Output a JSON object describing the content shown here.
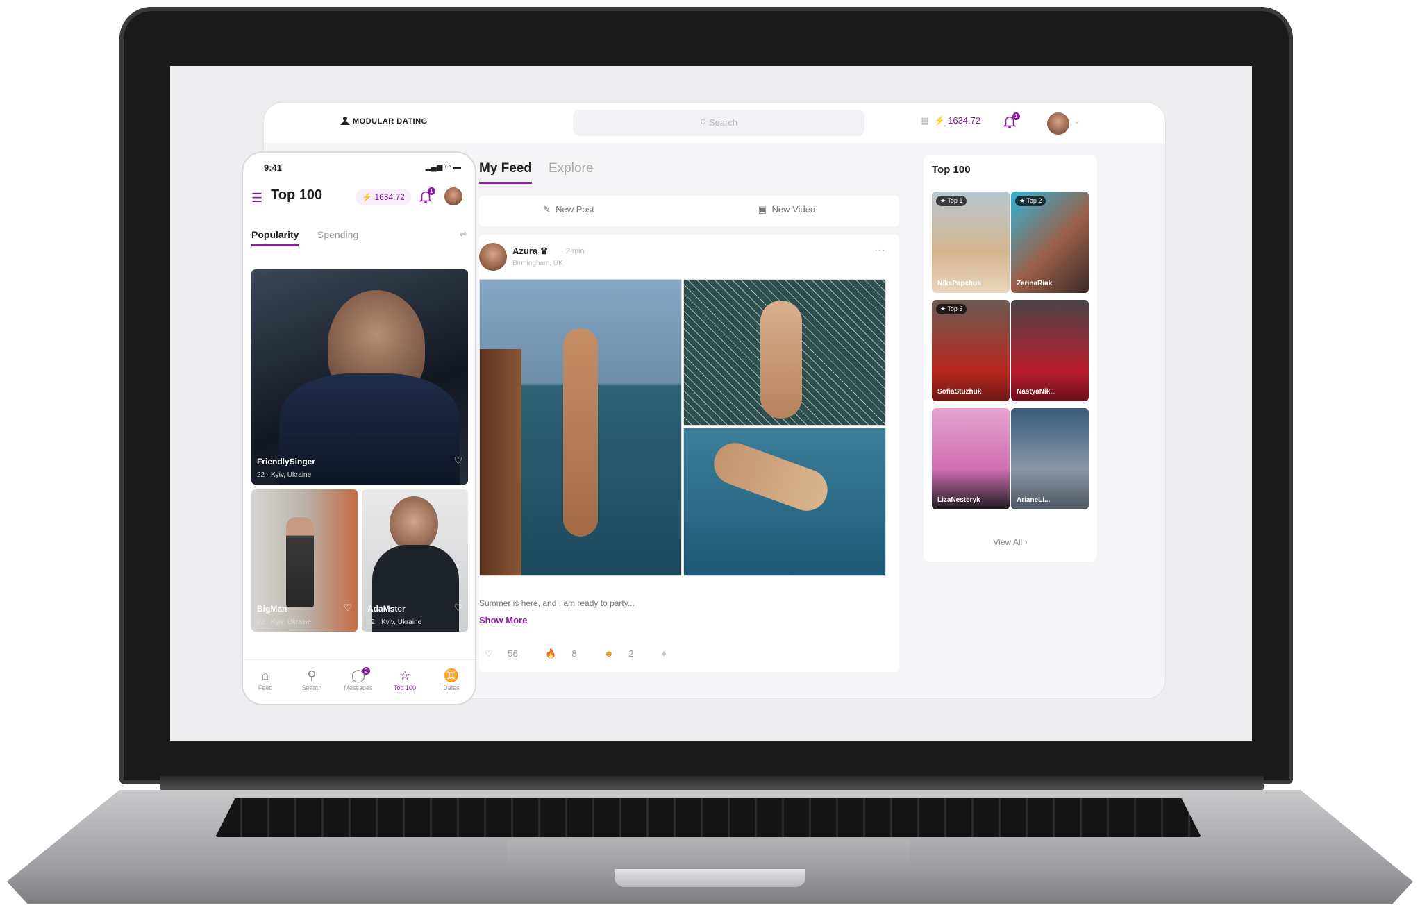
{
  "app": {
    "logo": "MODULAR DATING",
    "search_placeholder": "Search",
    "wallet": "1634.72",
    "notification_count": "1"
  },
  "phone": {
    "time": "9:41",
    "title": "Top 100",
    "wallet": "1634.72",
    "notification_count": "1",
    "tabs": [
      "Popularity",
      "Spending"
    ],
    "cards": [
      {
        "name": "FriendlySinger",
        "loc": "22 · Kyiv, Ukraine"
      },
      {
        "name": "BigMan",
        "loc": "22 · Kyiv, Ukraine"
      },
      {
        "name": "AdaMster",
        "loc": "22 · Kyiv, Ukraine"
      }
    ],
    "nav": [
      {
        "label": "Feed",
        "icon": "home-icon"
      },
      {
        "label": "Search",
        "icon": "search-icon"
      },
      {
        "label": "Messages",
        "icon": "messages-icon",
        "badge": "2"
      },
      {
        "label": "Top 100",
        "icon": "star-icon"
      },
      {
        "label": "Dates",
        "icon": "dates-icon"
      }
    ]
  },
  "feed": {
    "tabs": [
      "My Feed",
      "Explore"
    ],
    "new_post": "New Post",
    "new_video": "New Video",
    "post": {
      "author": "Azura",
      "time": "· 2 min",
      "location": "Birmingham, UK",
      "caption": "Summer is here, and I am ready to party...",
      "show_more": "Show More",
      "reactions": {
        "likes": "56",
        "fire": "8",
        "smile": "2"
      }
    }
  },
  "top100": {
    "title": "Top 100",
    "cards": [
      {
        "rank": "Top 1",
        "name": "NikaPapchuk"
      },
      {
        "rank": "Top 2",
        "name": "ZarinaRiak"
      },
      {
        "rank": "Top 3",
        "name": "SofiaStuzhuk"
      },
      {
        "rank": "",
        "name": "NastyaNik..."
      },
      {
        "rank": "",
        "name": "LizaNesteryk"
      },
      {
        "rank": "",
        "name": "ArianeLi..."
      }
    ],
    "view_all": "View All ›"
  },
  "colors": {
    "accent": "#8a1f9e",
    "background": "#f5f5f8"
  }
}
